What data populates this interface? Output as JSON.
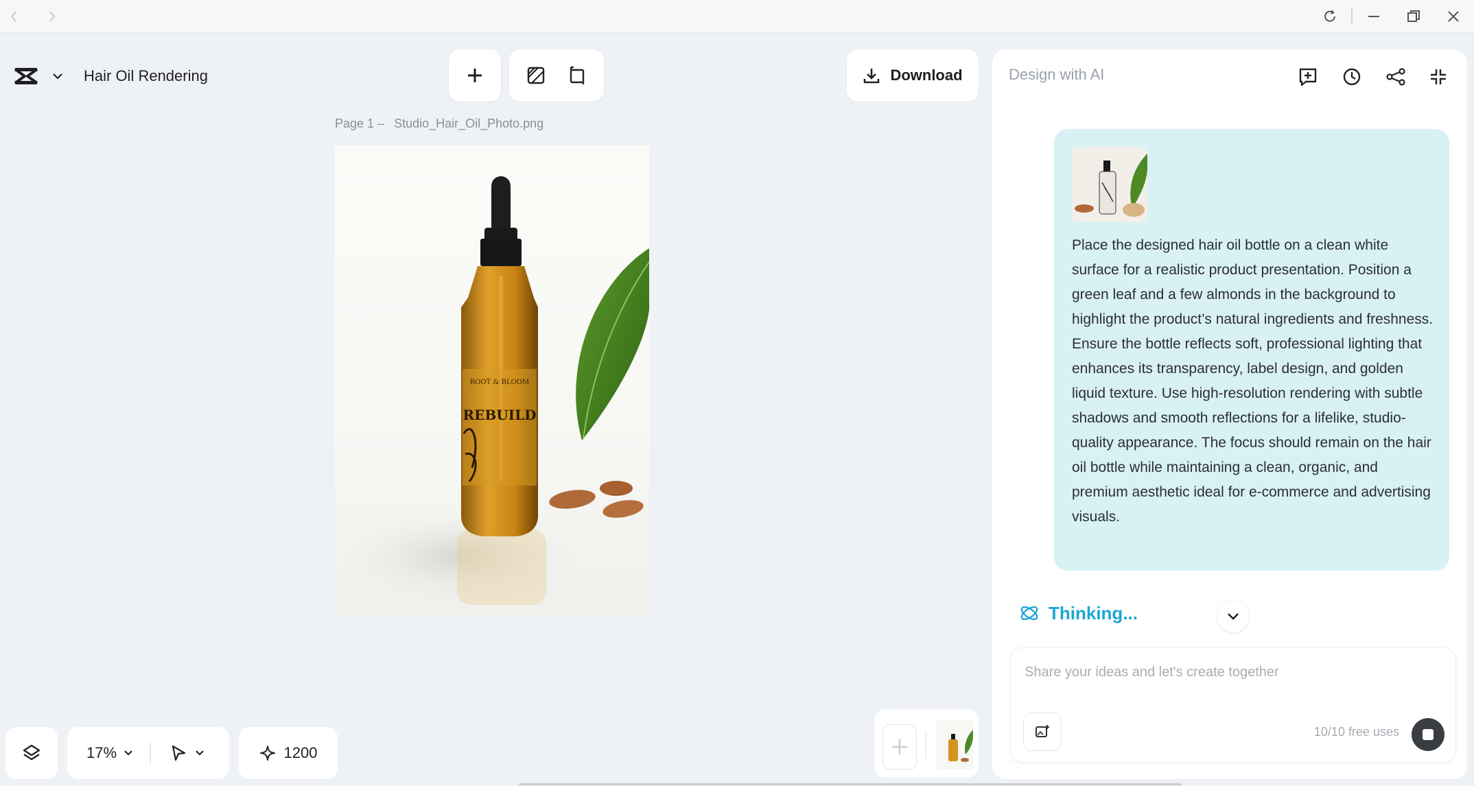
{
  "window": {
    "back_icon": "chevron-left-icon",
    "forward_icon": "chevron-right-icon",
    "reload_icon": "reload-icon",
    "minimize_icon": "minimize-icon",
    "restore_icon": "restore-icon",
    "close_icon": "close-icon"
  },
  "header": {
    "app_logo": "capcut-logo",
    "project_title": "Hair Oil Rendering",
    "add_icon": "plus-icon",
    "download_label": "Download"
  },
  "canvas": {
    "page_label": "Page 1 –",
    "file_name": "Studio_Hair_Oil_Photo.png",
    "bottle_label_brand": "ROOT & BLOOM",
    "bottle_label_name": "REBUILD"
  },
  "panel": {
    "title": "Design with AI",
    "message_text": "Place the designed hair oil bottle on a clean white surface for a realistic product presentation. Position a green leaf and a few almonds in the background to highlight the product’s natural ingredients and freshness. Ensure the bottle reflects soft, professional lighting that enhances its transparency, label design, and golden liquid texture. Use high-resolution rendering with subtle shadows and smooth reflections for a lifelike, studio-quality appearance. The focus should remain on the hair oil bottle while maintaining a clean, organic, and premium aesthetic ideal for e-commerce and advertising visuals.",
    "thinking_label": "Thinking...",
    "composer_placeholder": "Share your ideas and let's create together",
    "free_uses": "10/10 free uses"
  },
  "bottom_toolbar": {
    "zoom": "17%",
    "credits": "1200"
  },
  "colors": {
    "accent": "#1aa6d6",
    "bubble": "#d8f1f4",
    "background": "#eef1f5"
  }
}
